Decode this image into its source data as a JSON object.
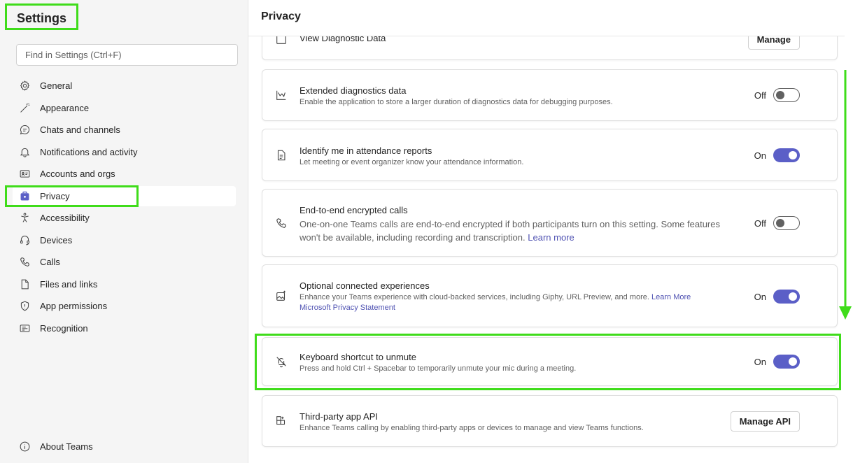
{
  "sidebar": {
    "title": "Settings",
    "search_placeholder": "Find in Settings (Ctrl+F)",
    "items": [
      {
        "label": "General",
        "icon": "gear-icon"
      },
      {
        "label": "Appearance",
        "icon": "magic-wand-icon"
      },
      {
        "label": "Chats and channels",
        "icon": "chat-icon"
      },
      {
        "label": "Notifications and activity",
        "icon": "bell-icon"
      },
      {
        "label": "Accounts and orgs",
        "icon": "contact-card-icon"
      },
      {
        "label": "Privacy",
        "icon": "briefcase-lock-icon",
        "active": true
      },
      {
        "label": "Accessibility",
        "icon": "accessibility-icon"
      },
      {
        "label": "Devices",
        "icon": "headset-icon"
      },
      {
        "label": "Calls",
        "icon": "phone-icon"
      },
      {
        "label": "Files and links",
        "icon": "document-icon"
      },
      {
        "label": "App permissions",
        "icon": "shield-icon"
      },
      {
        "label": "Recognition",
        "icon": "recognition-icon"
      }
    ],
    "about": "About Teams"
  },
  "main": {
    "title": "Privacy",
    "cards": {
      "diagnostic": {
        "title": "View Diagnostic Data",
        "button": "Manage"
      },
      "extended": {
        "title": "Extended diagnostics data",
        "desc": "Enable the application to store a larger duration of diagnostics data for debugging purposes.",
        "state": "Off"
      },
      "attendance": {
        "title": "Identify me in attendance reports",
        "desc": "Let meeting or event organizer know your attendance information.",
        "state": "On"
      },
      "e2e": {
        "title": "End-to-end encrypted calls",
        "desc": "One-on-one Teams calls are end-to-end encrypted if both participants turn on this setting. Some features won't be available, including recording and transcription.",
        "link": "Learn more",
        "state": "Off"
      },
      "connected": {
        "title": "Optional connected experiences",
        "desc": "Enhance your Teams experience with cloud-backed services, including Giphy, URL Preview, and more.",
        "link1": "Learn More",
        "link2": "Microsoft Privacy Statement",
        "state": "On"
      },
      "unmute": {
        "title": "Keyboard shortcut to unmute",
        "desc": "Press and hold Ctrl + Spacebar to temporarily unmute your mic during a meeting.",
        "state": "On"
      },
      "thirdparty": {
        "title": "Third-party app API",
        "desc": "Enhance Teams calling by enabling third-party apps or devices to manage and view Teams functions.",
        "button": "Manage API"
      }
    }
  },
  "colors": {
    "accent": "#5b5fc7",
    "highlight": "#3fdc1a",
    "link": "#4f52b2"
  }
}
